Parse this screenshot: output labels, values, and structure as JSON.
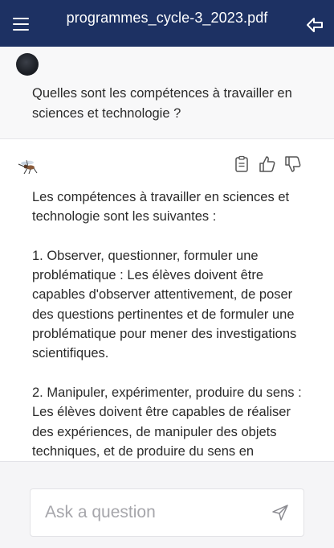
{
  "header": {
    "title": "programmes_cycle-3_2023.pdf",
    "menu_icon": "hamburger-menu-icon",
    "back_icon": "back-arrow-icon"
  },
  "user_message": {
    "text": "Quelles sont les compétences à travailler en sciences et technologie ?"
  },
  "bot_message": {
    "avatar_icon": "mosquito-icon",
    "actions": [
      "clipboard-icon",
      "thumbs-up-icon",
      "thumbs-down-icon"
    ],
    "text": "Les compétences à travailler en sciences et technologie sont les suivantes :\n\n1. Observer, questionner, formuler une problématique : Les élèves doivent être capables d'observer attentivement, de poser des questions pertinentes et de formuler une problématique pour mener des investigations scientifiques.\n\n2. Manipuler, expérimenter, produire du sens : Les élèves doivent être capables de réaliser des expériences, de manipuler des objets techniques, et de produire du sens en"
  },
  "composer": {
    "placeholder": "Ask a question",
    "value": ""
  },
  "colors": {
    "header_bg": "#1d3163",
    "user_bg": "#f8f8f9",
    "footer_bg": "#f5f5f7"
  }
}
